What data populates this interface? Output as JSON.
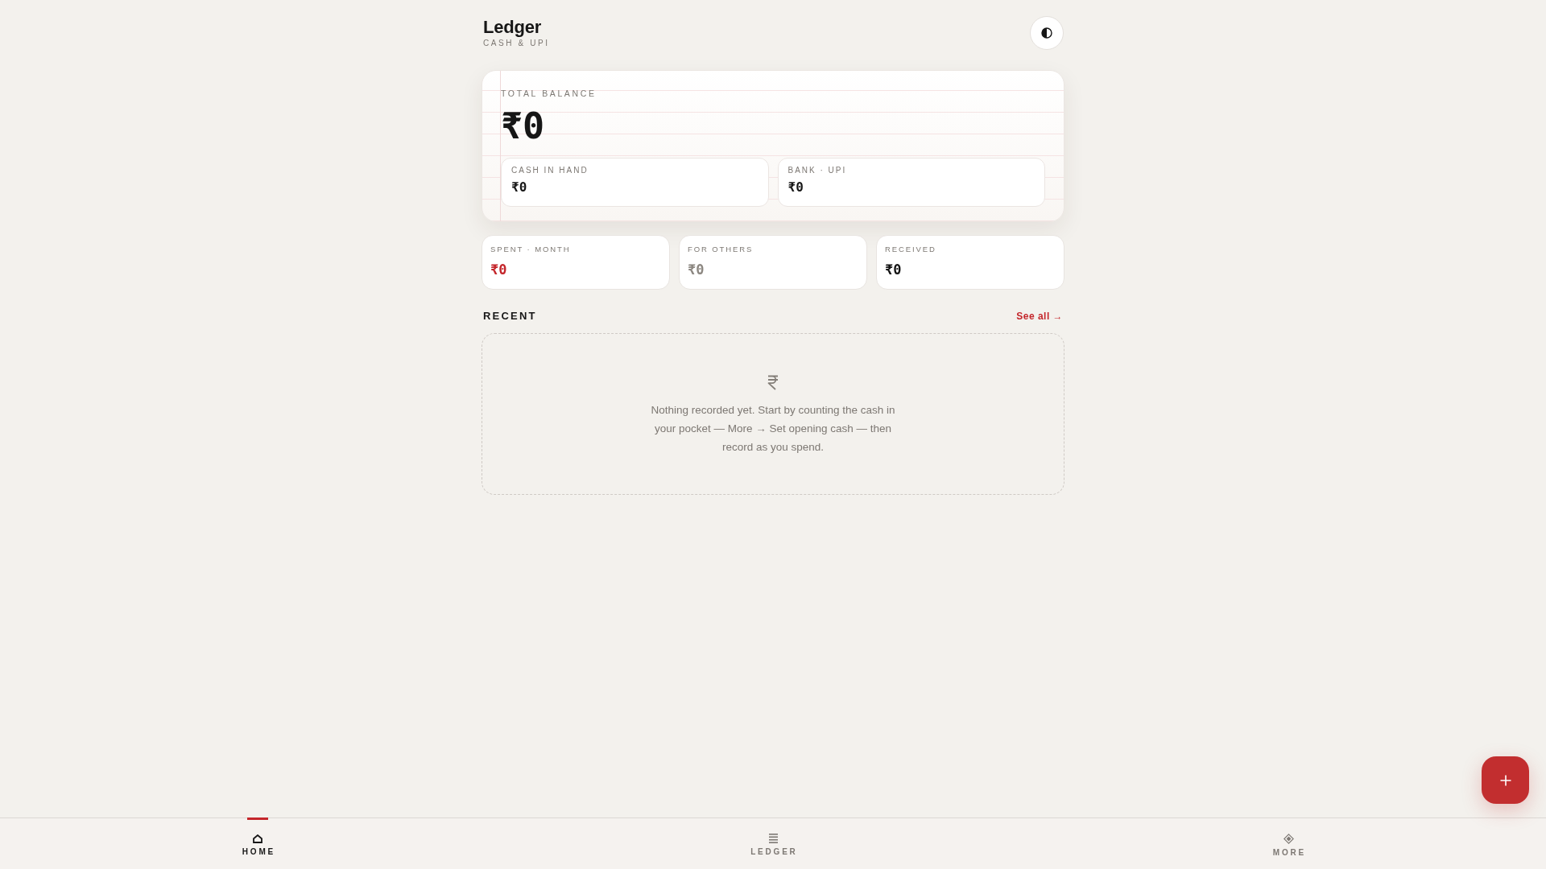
{
  "header": {
    "title": "Ledger",
    "subtitle": "CASH & UPI"
  },
  "balance": {
    "label": "TOTAL BALANCE",
    "amount": "₹0",
    "accounts": [
      {
        "label": "CASH IN HAND",
        "amount": "₹0"
      },
      {
        "label": "BANK · UPI",
        "amount": "₹0"
      }
    ]
  },
  "stats": [
    {
      "label": "SPENT · MONTH",
      "amount": "₹0",
      "color": "#c4262b"
    },
    {
      "label": "FOR OTHERS",
      "amount": "₹0",
      "color": "#8c8781"
    },
    {
      "label": "RECEIVED",
      "amount": "₹0",
      "color": "#141414"
    }
  ],
  "recent": {
    "title": "RECENT",
    "link": "See all →",
    "empty_message": "Nothing recorded yet. Start by counting the cash in your pocket — More → Set opening cash — then record as you spend."
  },
  "nav": [
    {
      "label": "HOME",
      "selected": true
    },
    {
      "label": "LEDGER",
      "selected": false
    },
    {
      "label": "MORE",
      "selected": false
    }
  ]
}
